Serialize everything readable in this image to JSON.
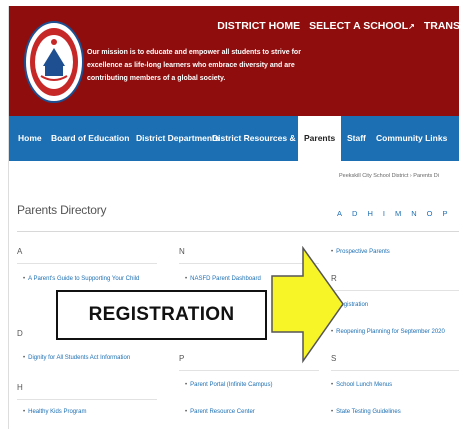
{
  "topnav": {
    "district_home": "DISTRICT HOME",
    "select_school": "SELECT A SCHOOL",
    "select_school_icon": "external-link-icon",
    "translate": "TRANS"
  },
  "header": {
    "logo_text": "Peekskill City School District",
    "mission_lines": [
      "Our mission is to educate and empower all students to strive for",
      "excellence as life-long learners who embrace diversity and are",
      "contributing members of a global society."
    ],
    "background_color": "#8f0d0d"
  },
  "mainnav": {
    "background_color": "#1d6fb3",
    "items": [
      {
        "label": "Home"
      },
      {
        "label": "Board of Education"
      },
      {
        "label": "District Departments"
      },
      {
        "label": "District Resources & Media"
      },
      {
        "label": "Parents",
        "active": true
      },
      {
        "label": "Staff"
      },
      {
        "label": "Community Links"
      }
    ]
  },
  "breadcrumb": {
    "root": "Peekskill City School District",
    "separator": "›",
    "current": "Parents Di"
  },
  "page": {
    "title": "Parents Directory",
    "alpha_index": [
      "A",
      "D",
      "H",
      "I",
      "M",
      "N",
      "O",
      "P"
    ]
  },
  "directory": {
    "col1": {
      "heads": [
        "A",
        "D",
        "H"
      ],
      "links": [
        "A Parent's Guide to Supporting Your Child",
        "Dignity for All Students Act Information",
        "Healthy Kids Program"
      ]
    },
    "col2": {
      "heads": [
        "N",
        "P"
      ],
      "links": [
        "NASFD Parent Dashboard",
        "Parent Portal (Infinite Campus)",
        "Parent Resource Center"
      ]
    },
    "col3": {
      "heads": [
        "R",
        "S"
      ],
      "links": [
        "Prospective Parents",
        "Registration",
        "Reopening Planning for September 2020",
        "School Lunch Menus",
        "State Testing Guidelines"
      ]
    }
  },
  "callout": {
    "label": "REGISTRATION",
    "arrow_color": "#f7f428"
  }
}
